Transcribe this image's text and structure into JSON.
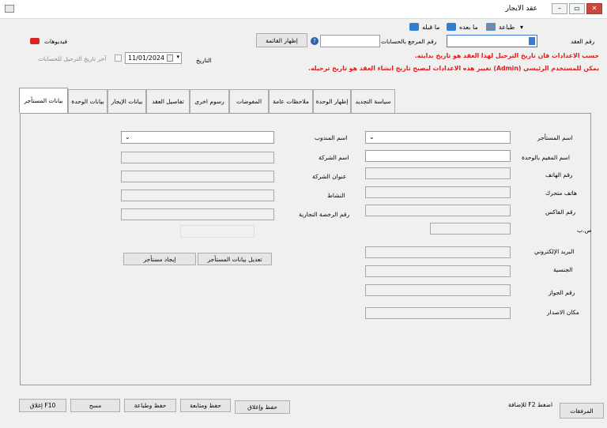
{
  "window": {
    "title": "عقد الايجار"
  },
  "toolbar": {
    "dropdown": "▾",
    "print": "طباعة",
    "next": "ما بعده",
    "prev": "ما قبله"
  },
  "header": {
    "contract_no_label": "رقم العقد",
    "contract_no_value": "",
    "ref_no_label": "رقم المرجع بالحسابات",
    "ref_no_value": "",
    "help_glyph": "?",
    "show_list_button": "إظهار القائمة",
    "videos_label": "فيديوهات",
    "date_label": "التاريخ",
    "date_value": "11/01/2024",
    "last_posting_label": "آخر تاريخ الترحيل للحسابات"
  },
  "notices": [
    "حسب الاعدادات فان تاريخ الترحيل لهذا العقد هو تاريخ بدايته.",
    "يمكن للمستخدم الرئيسي (Admin) تغيير هذه الاعدادات ليصبح تاريخ انشاء العقد هو تاريخ ترحيله."
  ],
  "tabs": [
    "بيانات المستأجر",
    "بيانات الوحدة",
    "بيانات الإيجار",
    "تفاصيل العقد",
    "رسوم اخرى",
    "المفوضات",
    "ملاحظات عامة",
    "إظهار الوحدة",
    "سياسة التجديد"
  ],
  "tenant_form": {
    "right_fields": [
      "اسم المستأجر",
      "اسم المقيم بالوحدة",
      "رقم الهاتف",
      "هاتف متحرك",
      "رقم الفاكس",
      "ص.ب",
      "البريد الإلكتروني",
      "الجنسية",
      "رقم الجواز",
      "مكان الاصدار"
    ],
    "left_fields": [
      "اسم المندوب",
      "اسم الشركة",
      "عنوان الشركة",
      "النشاط",
      "رقم الرخصة التجارية"
    ],
    "edit_tenant_button": "تعديل بيانات المستأجر",
    "find_tenant_button": "إيجاد مستأجر"
  },
  "footer": {
    "attachments_button": "المرفقات",
    "f2_hint": "اضغط F2 للإضافة",
    "save_close_button": "حفظ وإغلاق",
    "save_continue_button": "حفظ ومتابعة",
    "save_print_button": "حفظ وطباعة",
    "clear_button": "مسح",
    "close_button": "إغلاق F10"
  }
}
